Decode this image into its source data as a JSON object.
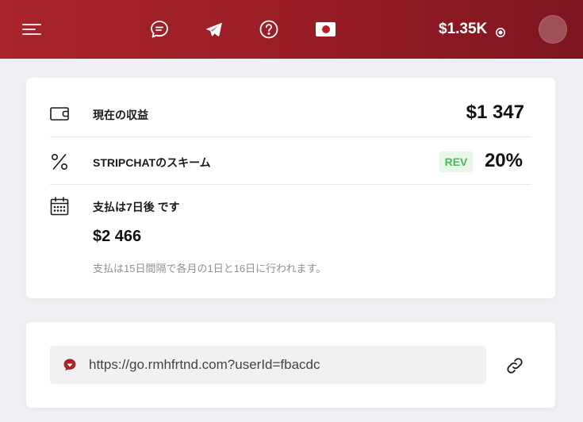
{
  "header": {
    "balance": "$1.35K",
    "icons": [
      "menu-icon",
      "chat-icon",
      "telegram-icon",
      "help-icon",
      "japan-flag-icon",
      "eye-icon",
      "avatar"
    ]
  },
  "earnings": {
    "label": "現在の収益",
    "value": "$1 347"
  },
  "scheme": {
    "label": "STRIPCHATのスキーム",
    "badge": "REV",
    "rate": "20%"
  },
  "payout": {
    "label": "支払は7日後 です",
    "amount": "$2 466",
    "note": "支払は15日間隔で各月の1日と16日に行われます。"
  },
  "referral": {
    "url": "https://go.rmhfrtnd.com?userId=fbacdc"
  },
  "colors": {
    "header_start": "#a8232a",
    "header_end": "#7c1520",
    "rev_badge_bg": "#e8f7ea",
    "rev_badge_text": "#4cb85b",
    "page_bg": "#eff0f3"
  }
}
